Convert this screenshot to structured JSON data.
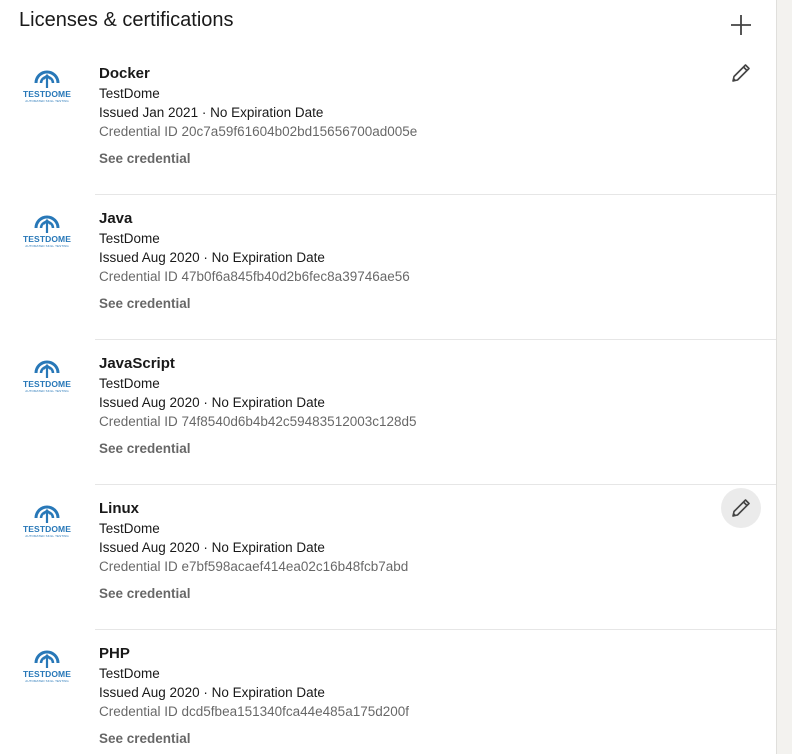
{
  "section": {
    "title": "Licenses & certifications"
  },
  "icons": {
    "add": "plus-icon",
    "edit": "pencil-icon",
    "logo": "testdome-logo"
  },
  "colors": {
    "logo_blue": "#2878b8",
    "muted_text": "#666666",
    "hover_bg": "#ebebeb"
  },
  "items": [
    {
      "title": "Docker",
      "issuer": "TestDome",
      "logo_name": "TESTDOME",
      "logo_tagline": "AUTOMATED SKILL TESTING",
      "issued": "Issued Jan 2021 · No Expiration Date",
      "credential_id": "Credential ID 20c7a59f61604b02bd15656700ad005e",
      "see_credential": "See credential",
      "edit_visible": true,
      "edit_hover": false
    },
    {
      "title": "Java",
      "issuer": "TestDome",
      "logo_name": "TESTDOME",
      "logo_tagline": "AUTOMATED SKILL TESTING",
      "issued": "Issued Aug 2020 · No Expiration Date",
      "credential_id": "Credential ID 47b0f6a845fb40d2b6fec8a39746ae56",
      "see_credential": "See credential",
      "edit_visible": false,
      "edit_hover": false
    },
    {
      "title": "JavaScript",
      "issuer": "TestDome",
      "logo_name": "TESTDOME",
      "logo_tagline": "AUTOMATED SKILL TESTING",
      "issued": "Issued Aug 2020 · No Expiration Date",
      "credential_id": "Credential ID 74f8540d6b4b42c59483512003c128d5",
      "see_credential": "See credential",
      "edit_visible": false,
      "edit_hover": false
    },
    {
      "title": "Linux",
      "issuer": "TestDome",
      "logo_name": "TESTDOME",
      "logo_tagline": "AUTOMATED SKILL TESTING",
      "issued": "Issued Aug 2020 · No Expiration Date",
      "credential_id": "Credential ID e7bf598acaef414ea02c16b48fcb7abd",
      "see_credential": "See credential",
      "edit_visible": true,
      "edit_hover": true
    },
    {
      "title": "PHP",
      "issuer": "TestDome",
      "logo_name": "TESTDOME",
      "logo_tagline": "AUTOMATED SKILL TESTING",
      "issued": "Issued Aug 2020 · No Expiration Date",
      "credential_id": "Credential ID dcd5fbea151340fca44e485a175d200f",
      "see_credential": "See credential",
      "edit_visible": false,
      "edit_hover": false
    }
  ]
}
